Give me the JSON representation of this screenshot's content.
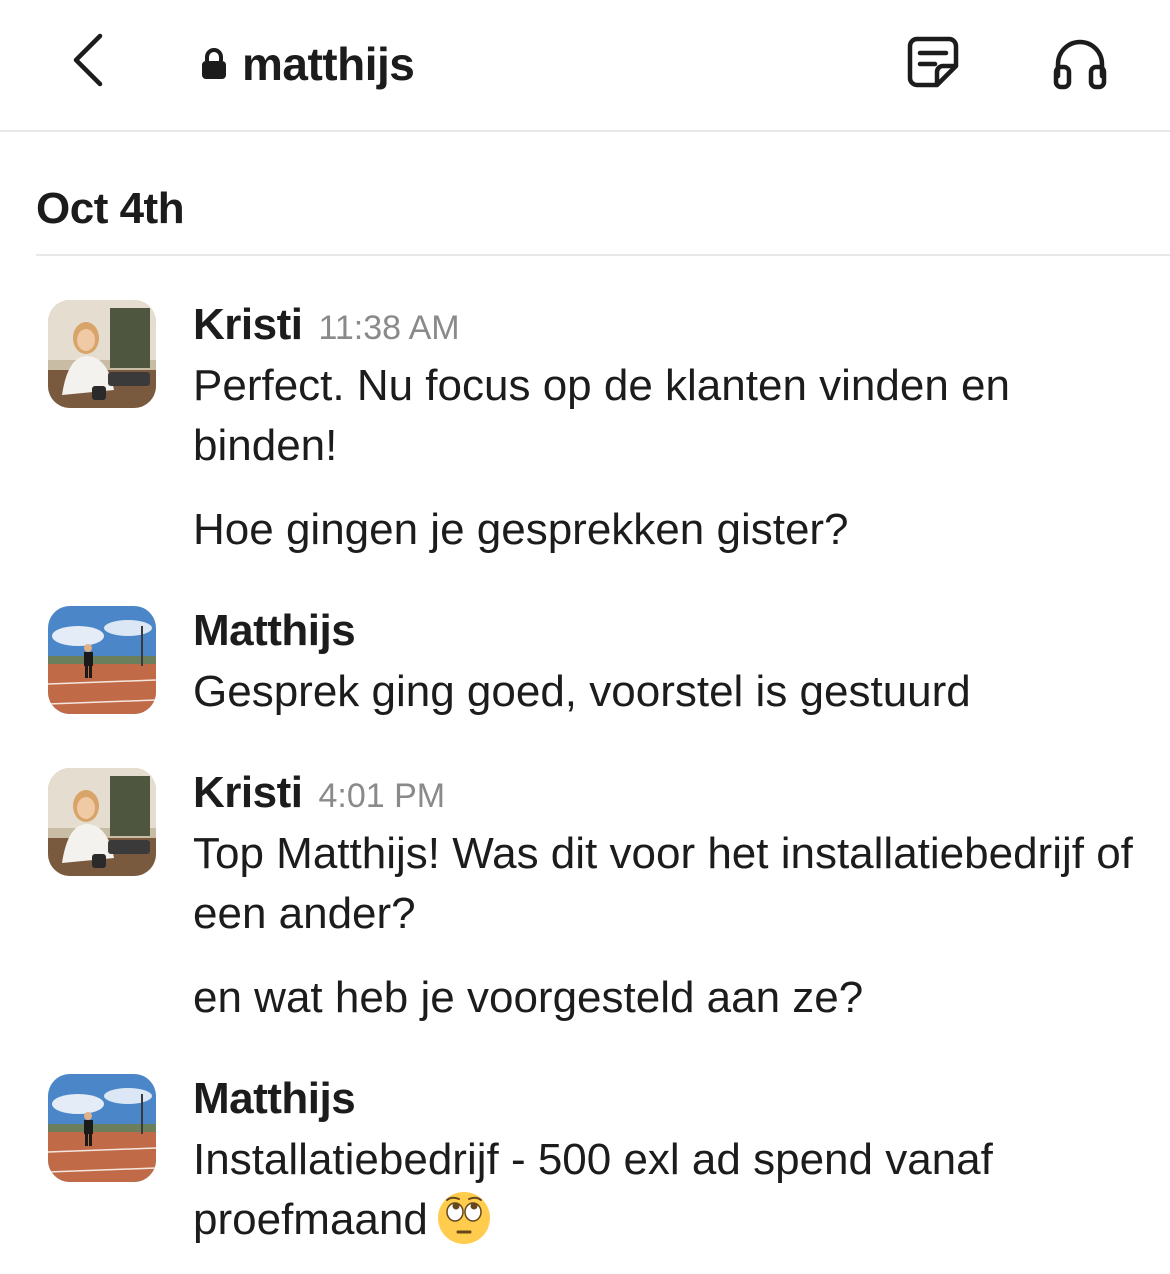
{
  "header": {
    "title": "matthijs",
    "back_icon": "chevron-left-icon",
    "lock_icon": "lock-icon",
    "canvas_icon": "canvas-icon",
    "huddle_icon": "headphones-icon"
  },
  "date_divider": {
    "label": "Oct 4th"
  },
  "messages": [
    {
      "sender": "Kristi",
      "time": "11:38 AM",
      "lines": [
        "Perfect. Nu focus op de klanten vinden en binden!",
        "Hoe gingen je gesprekken gister?"
      ]
    },
    {
      "sender": "Matthijs",
      "time": "",
      "lines": [
        "Gesprek ging goed, voorstel is gestuurd"
      ]
    },
    {
      "sender": "Kristi",
      "time": "4:01 PM",
      "lines": [
        "Top Matthijs! Was dit voor het installatiebedrijf of een ander?",
        "en wat heb je voorgesteld aan ze?"
      ]
    },
    {
      "sender": "Matthijs",
      "time": "",
      "lines": [
        "Installatiebedrijf - 500 exl ad spend vanaf proefmaand"
      ],
      "emoji": "face-with-rolling-eyes-emoji"
    }
  ],
  "colors": {
    "text": "#1d1c1d",
    "timestamp": "#8a8a8a",
    "divider": "#e8e8e8"
  }
}
